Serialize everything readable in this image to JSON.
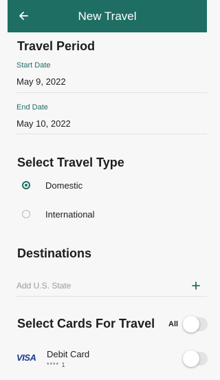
{
  "header": {
    "title": "New Travel",
    "back_icon": "arrow-left-icon"
  },
  "travel_period": {
    "title": "Travel Period",
    "start_label": "Start Date",
    "start_value": "May 9, 2022",
    "end_label": "End Date",
    "end_value": "May 10, 2022"
  },
  "travel_type": {
    "title": "Select Travel Type",
    "options": [
      {
        "label": "Domestic",
        "selected": true
      },
      {
        "label": "International",
        "selected": false
      }
    ]
  },
  "destinations": {
    "title": "Destinations",
    "placeholder": "Add U.S. State",
    "add_icon": "plus-icon"
  },
  "cards": {
    "title": "Select Cards For Travel",
    "all_label": "All",
    "all_enabled": false,
    "items": [
      {
        "brand": "VISA",
        "name": "Debit Card",
        "number": "****    1",
        "enabled": false
      }
    ]
  },
  "colors": {
    "primary": "#1f6e64",
    "background": "#f7f7f7",
    "visa_blue": "#1a3d8f"
  }
}
